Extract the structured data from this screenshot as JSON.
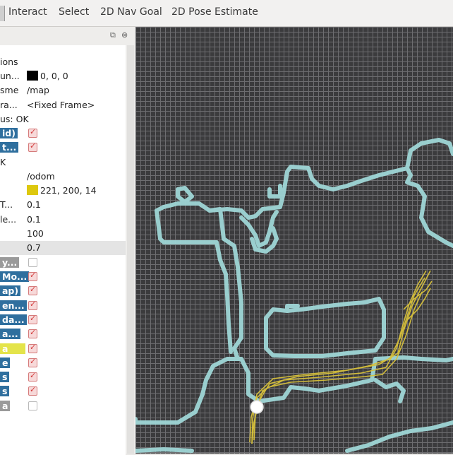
{
  "toolbar": {
    "interact": "Interact",
    "select": "Select",
    "nav_goal": "2D Nav Goal",
    "pose_estimate": "2D Pose Estimate"
  },
  "panel": {
    "float_icon": "undock-icon",
    "close_icon": "close-icon",
    "rows": [
      {
        "key": "ions",
        "value": ""
      },
      {
        "key": "un...",
        "value": "0, 0, 0"
      },
      {
        "key": "sme",
        "value": "/map"
      },
      {
        "key": "ra...",
        "value": "<Fixed Frame>"
      },
      {
        "key": "us: OK",
        "value": ""
      },
      {
        "key": "id)",
        "value": ""
      },
      {
        "key": "t...",
        "value": ""
      },
      {
        "key": "K",
        "value": ""
      },
      {
        "key": "",
        "value": "/odom"
      },
      {
        "key": "",
        "value": "221, 200, 14"
      },
      {
        "key": "T...",
        "value": "0.1"
      },
      {
        "key": "le...",
        "value": "0.1"
      },
      {
        "key": "",
        "value": "100"
      },
      {
        "key": "",
        "value": "0.7"
      },
      {
        "key": "y...",
        "value": ""
      },
      {
        "key": "Mo...",
        "value": ""
      },
      {
        "key": "ap)",
        "value": ""
      },
      {
        "key": "en...",
        "value": ""
      },
      {
        "key": "da...",
        "value": ""
      },
      {
        "key": "a...",
        "value": ""
      },
      {
        "key": "a",
        "value": ""
      },
      {
        "key": "e",
        "value": ""
      },
      {
        "key": "s",
        "value": ""
      },
      {
        "key": "s",
        "value": ""
      },
      {
        "key": "a",
        "value": ""
      }
    ]
  },
  "colors": {
    "background_swatch": "#000000",
    "odom_swatch": "#ddc80e",
    "map_background": "#3b3b3d",
    "map_walls": "#9fd6d6",
    "path_color": "#d9c23a",
    "robot_color": "#ffffff",
    "selected_row": "#2f6f9e",
    "highlight_row": "#e4e44a"
  }
}
